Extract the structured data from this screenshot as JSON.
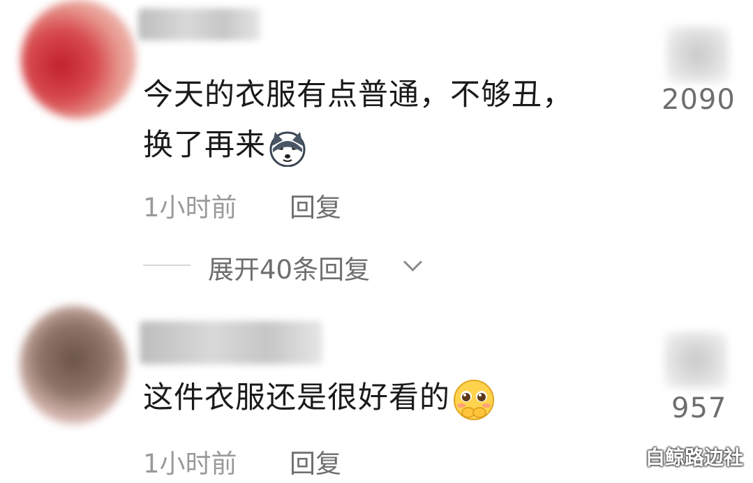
{
  "comments": [
    {
      "text_line1": "今天的衣服有点普通，不够丑，",
      "text_line2": "换了再来",
      "emoji": "husky-dog-emoji",
      "like_count": "2090",
      "time": "1小时前",
      "reply_label": "回复",
      "expand_label": "展开40条回复"
    },
    {
      "text_line1": "这件衣服还是很好看的",
      "emoji": "blushing-face-emoji",
      "like_count": "957",
      "time": "1小时前",
      "reply_label": "回复"
    }
  ],
  "watermark": "白鲸路边社"
}
